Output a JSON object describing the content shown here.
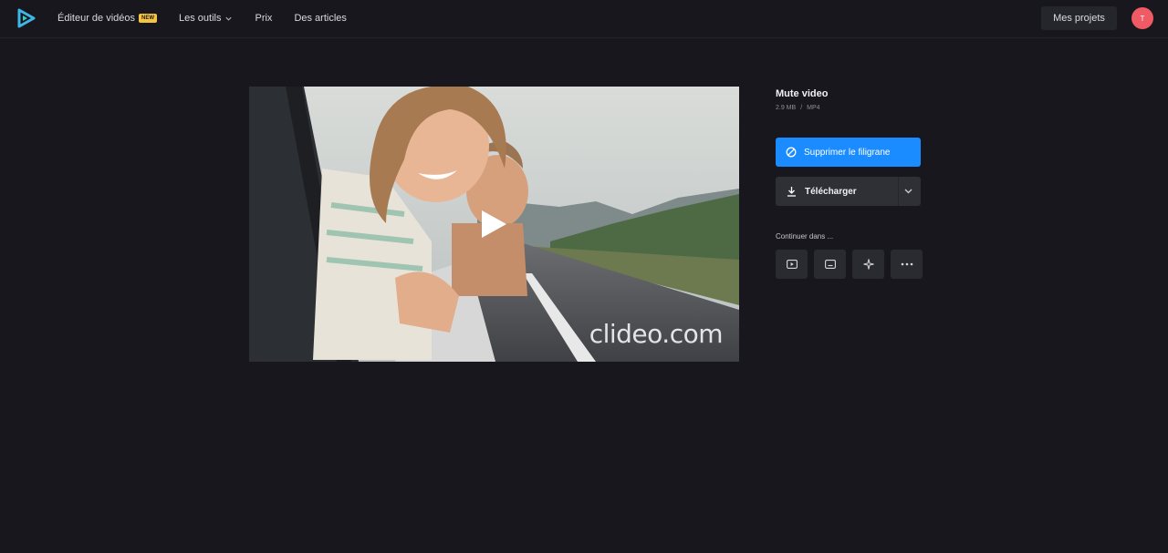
{
  "header": {
    "nav": [
      {
        "label": "Éditeur de vidéos",
        "badge": "NEW"
      },
      {
        "label": "Les outils"
      },
      {
        "label": "Prix"
      },
      {
        "label": "Des articles"
      }
    ],
    "projects_label": "Mes projets",
    "avatar_initial": "T"
  },
  "video": {
    "watermark": "clideo.com"
  },
  "file": {
    "title": "Mute video",
    "size": "2.9 MB",
    "separator": "/",
    "format": "MP4"
  },
  "actions": {
    "remove_watermark": "Supprimer le filigrane",
    "download": "Télécharger"
  },
  "continue": {
    "label": "Continuer dans ...",
    "tools": [
      "play-icon",
      "subtitles-icon",
      "sparkle-icon",
      "more-icon"
    ]
  },
  "colors": {
    "background": "#17171d",
    "accent": "#1a8cff",
    "badge": "#f5c542",
    "avatar": "#ef5a64"
  }
}
